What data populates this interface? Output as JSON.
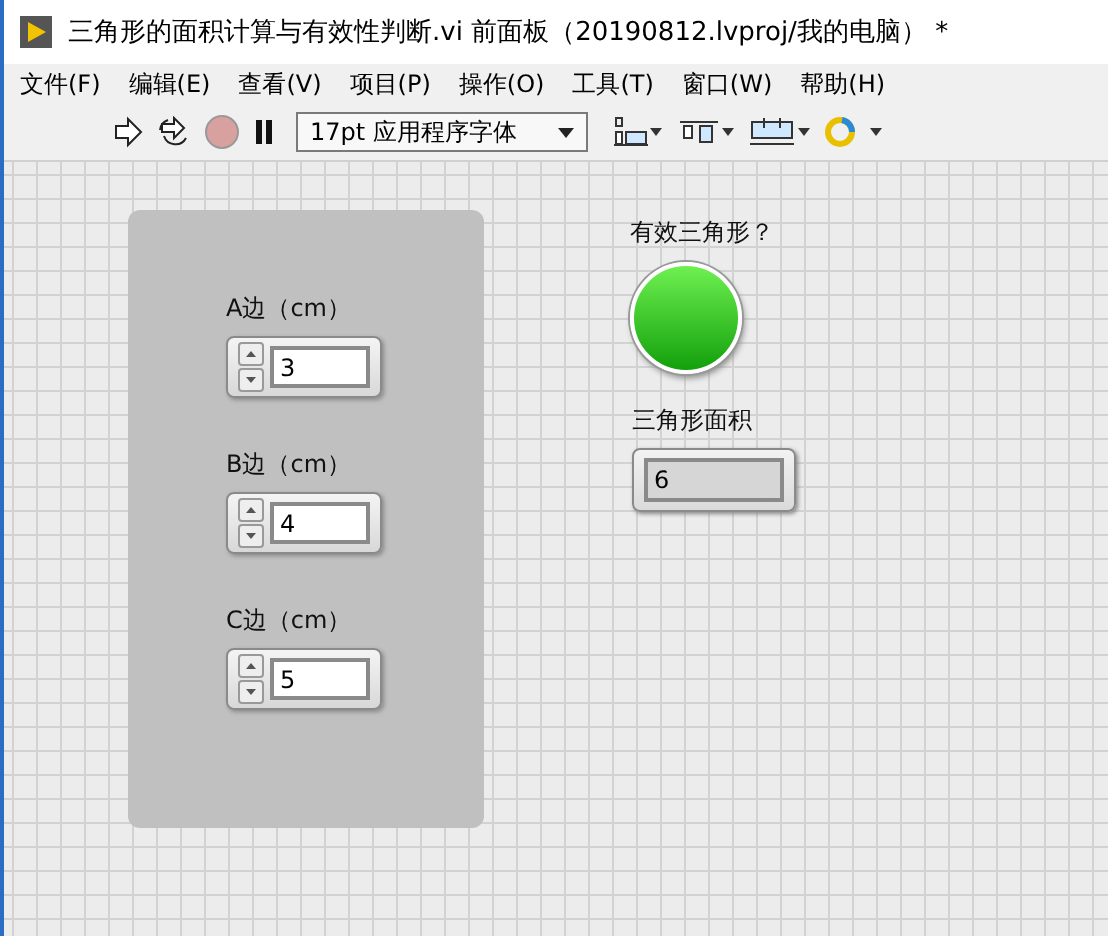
{
  "window": {
    "title": "三角形的面积计算与有效性判断.vi 前面板（20190812.lvproj/我的电脑） *"
  },
  "menu": [
    {
      "label": "文件(F)"
    },
    {
      "label": "编辑(E)"
    },
    {
      "label": "查看(V)"
    },
    {
      "label": "项目(P)"
    },
    {
      "label": "操作(O)"
    },
    {
      "label": "工具(T)"
    },
    {
      "label": "窗口(W)"
    },
    {
      "label": "帮助(H)"
    }
  ],
  "toolbar": {
    "font": "17pt 应用程序字体"
  },
  "controls": [
    {
      "label": "A边（cm）",
      "value": "3"
    },
    {
      "label": "B边（cm）",
      "value": "4"
    },
    {
      "label": "C边（cm）",
      "value": "5"
    }
  ],
  "indicators": [
    {
      "kind": "led",
      "label": "有效三角形？",
      "on": true
    },
    {
      "kind": "numeric",
      "label": "三角形面积",
      "value": "6"
    }
  ]
}
